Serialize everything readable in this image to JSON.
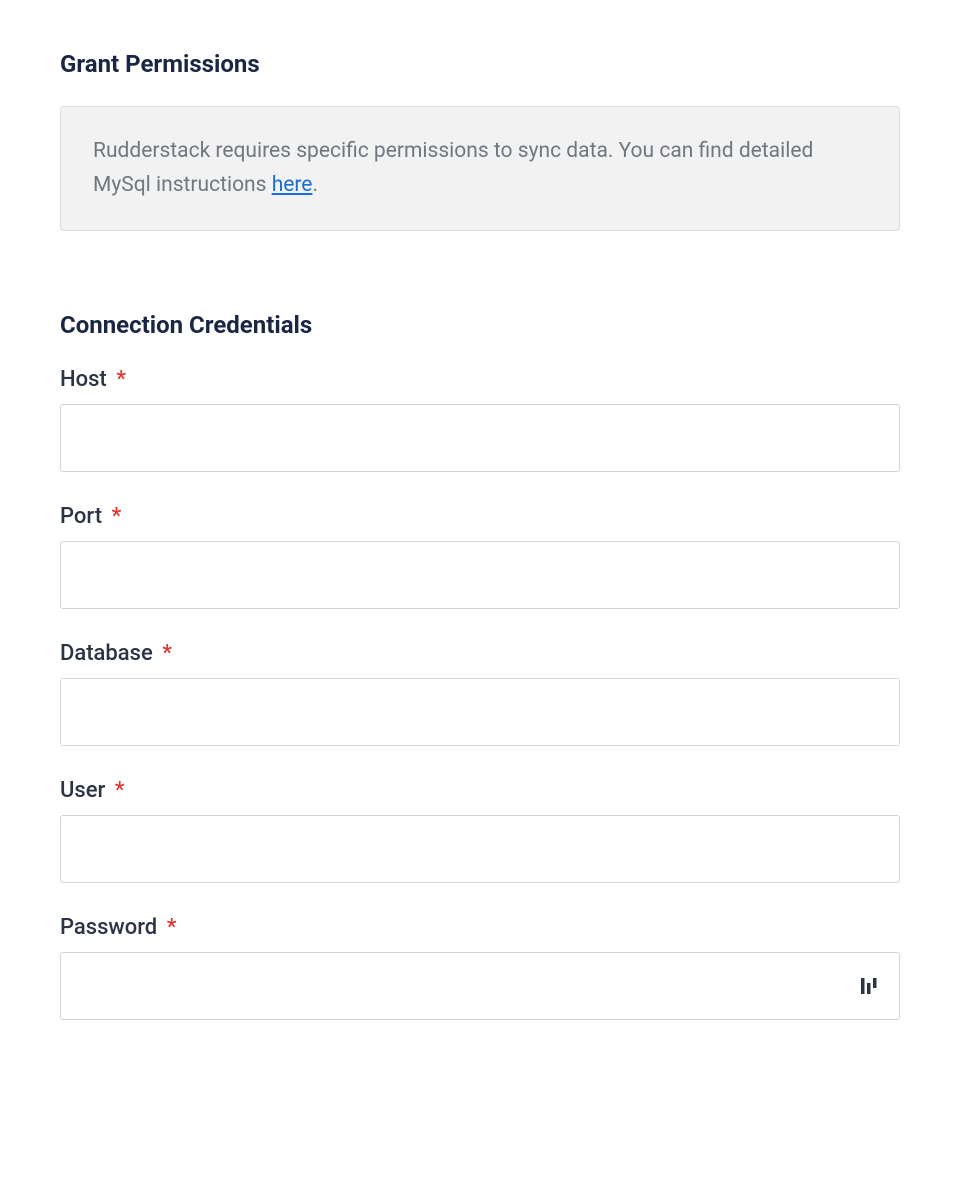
{
  "sections": {
    "grant_permissions": {
      "heading": "Grant Permissions",
      "info_text_before": "Rudderstack requires specific permissions to sync data. You can find detailed MySql instructions ",
      "info_link_text": "here",
      "info_text_after": "."
    },
    "connection_credentials": {
      "heading": "Connection Credentials",
      "fields": {
        "host": {
          "label": "Host",
          "value": ""
        },
        "port": {
          "label": "Port",
          "value": ""
        },
        "database": {
          "label": "Database",
          "value": ""
        },
        "user": {
          "label": "User",
          "value": ""
        },
        "password": {
          "label": "Password",
          "value": ""
        }
      }
    }
  },
  "required_marker": "*"
}
